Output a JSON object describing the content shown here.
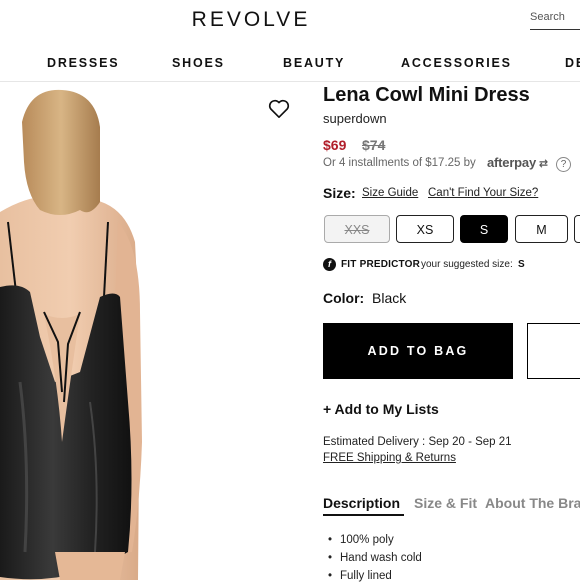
{
  "header": {
    "logo": "REVOLVE",
    "search_placeholder": "Search"
  },
  "nav": [
    "DRESSES",
    "SHOES",
    "BEAUTY",
    "ACCESSORIES",
    "DE"
  ],
  "product": {
    "title": "Lena Cowl Mini Dress",
    "brand": "superdown",
    "price_sale": "$69",
    "price_original": "$74",
    "installments": "Or 4 installments of $17.25 by",
    "installments_provider": "afterpay",
    "help_icon_text": "?",
    "size_label": "Size:",
    "size_guide": "Size Guide",
    "cant_find": "Can't Find Your Size?",
    "sizes": [
      {
        "label": "XXS",
        "state": "unavailable"
      },
      {
        "label": "XS",
        "state": "available"
      },
      {
        "label": "S",
        "state": "selected"
      },
      {
        "label": "M",
        "state": "available"
      },
      {
        "label": "",
        "state": "available"
      }
    ],
    "fit_predictor": "FIT PREDICTOR",
    "fit_text": "your suggested size:",
    "fit_size": "S",
    "color_label": "Color:",
    "color_value": "Black",
    "add_to_bag": "ADD TO BAG",
    "add_to_lists": "+ Add to My Lists",
    "delivery": "Estimated Delivery : Sep 20 - Sep 21",
    "shipping": "FREE Shipping & Returns",
    "tabs": [
      "Description",
      "Size & Fit",
      "About The Bra"
    ],
    "details": [
      "100% poly",
      "Hand wash cold",
      "Fully lined"
    ]
  },
  "colors": {
    "sale_price": "#b11f2b",
    "button_bg": "#000000"
  },
  "icons": {
    "wishlist": "heart-icon",
    "fit_predictor": "fit-predictor-icon"
  }
}
